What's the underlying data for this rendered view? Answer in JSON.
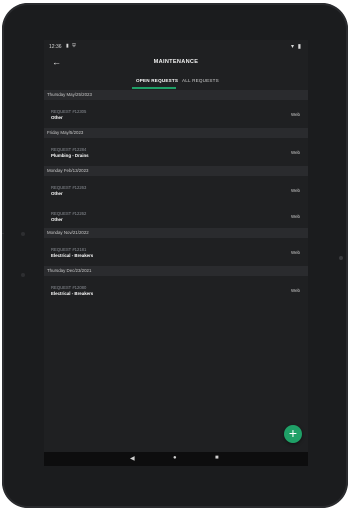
{
  "status": {
    "time": "12:36",
    "left_icons": "▮ ⛨",
    "right_icons": "▾ ▮"
  },
  "appbar": {
    "title": "MAINTENANCE",
    "back_icon": "←"
  },
  "tabs": [
    {
      "label": "OPEN REQUESTS",
      "active": true
    },
    {
      "label": "ALL REQUESTS",
      "active": false
    }
  ],
  "groups": [
    {
      "date": "Thursday May/25/2023",
      "items": [
        {
          "request": "REQUEST #12305",
          "category": "Other",
          "source": "Web"
        }
      ]
    },
    {
      "date": "Friday May/5/2023",
      "items": [
        {
          "request": "REQUEST #12284",
          "category": "Plumbing - Drains",
          "source": "Web"
        }
      ]
    },
    {
      "date": "Monday Feb/13/2023",
      "items": [
        {
          "request": "REQUEST #12263",
          "category": "Other",
          "source": "Web"
        },
        {
          "request": "REQUEST #12262",
          "category": "Other",
          "source": "Web"
        }
      ]
    },
    {
      "date": "Monday Nov/21/2022",
      "items": [
        {
          "request": "REQUEST #12181",
          "category": "Electrical - Breakers",
          "source": "Web"
        }
      ]
    },
    {
      "date": "Thursday Dec/23/2021",
      "items": [
        {
          "request": "REQUEST #12080",
          "category": "Electrical - Breakers",
          "source": "Web"
        }
      ]
    }
  ],
  "fab": {
    "label": "+"
  },
  "nav": {
    "back": "◀",
    "home": "●",
    "recent": "■"
  },
  "colors": {
    "accent": "#1fa067",
    "background": "#1f2022",
    "header": "#2a2b2e"
  }
}
